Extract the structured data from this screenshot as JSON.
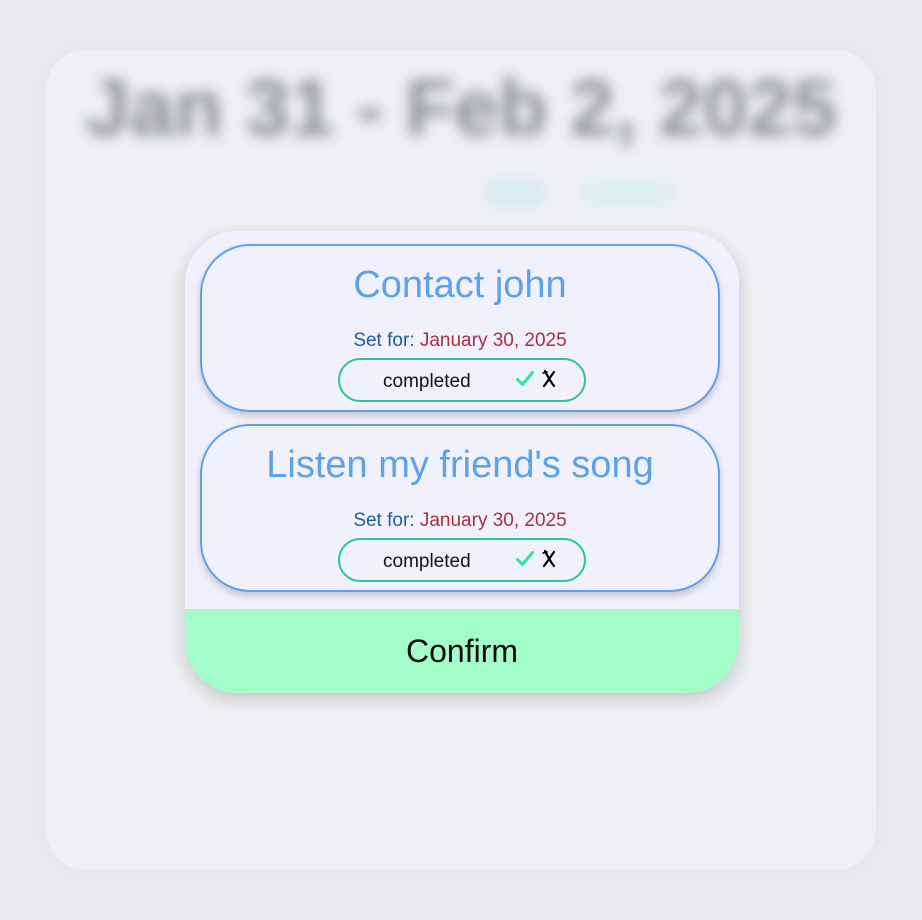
{
  "background": {
    "title": "Jan 31 - Feb 2, 2025",
    "tabs": [
      "",
      "",
      "",
      ""
    ]
  },
  "tasks": [
    {
      "title": "Contact john",
      "set_for_label": "Set for:",
      "date": "January 30, 2025",
      "status": "completed",
      "confirm_icon": "check-icon",
      "reject_icon": "x-icon"
    },
    {
      "title": "Listen my friend's song",
      "set_for_label": "Set for:",
      "date": "January 30, 2025",
      "status": "completed",
      "confirm_icon": "check-icon",
      "reject_icon": "x-icon"
    }
  ],
  "confirm_label": "Confirm",
  "colors": {
    "title_blue": "#5da1e9",
    "date_red": "#ad2e3a",
    "label_blue": "#1e5c9c",
    "status_green": "#26c98a",
    "confirm_bg": "#a2fdc8"
  }
}
